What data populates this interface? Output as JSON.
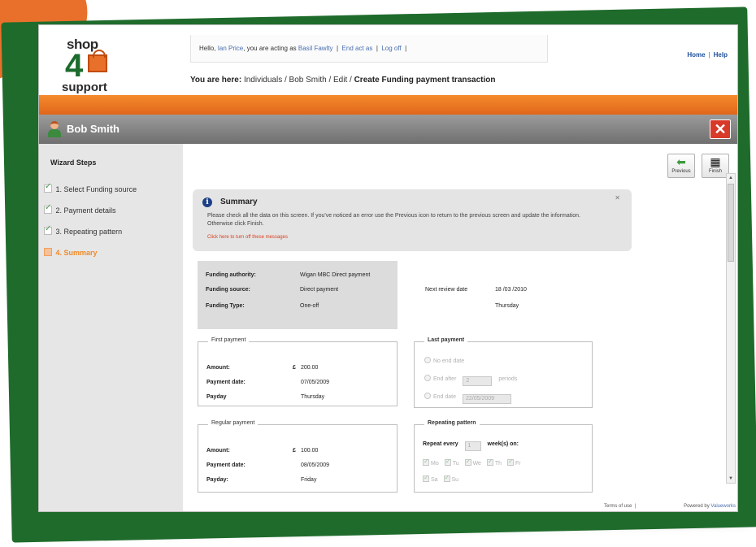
{
  "logo": {
    "line1": "shop",
    "number": "4",
    "line2": "support"
  },
  "user_bar": {
    "greeting_prefix": "Hello,",
    "user_name": "Ian Price",
    "acting_text": ", you are acting as",
    "acting_as": "Basil Fawlty",
    "sep": "|",
    "end_act": "End act as",
    "log_off": "Log off"
  },
  "breadcrumb": {
    "prefix": "You are here:",
    "path": "Individuals / Bob Smith / Edit /",
    "current": "Create Funding payment transaction"
  },
  "top_links": {
    "home": "Home",
    "sep": "|",
    "help": "Help"
  },
  "person": {
    "name": "Bob Smith",
    "close": "✕"
  },
  "wizard": {
    "title": "Wizard Steps",
    "steps": [
      {
        "label": "1. Select Funding source",
        "done": true
      },
      {
        "label": "2. Payment details",
        "done": true
      },
      {
        "label": "3. Repeating pattern",
        "done": true
      },
      {
        "label": "4. Summary",
        "active": true
      }
    ]
  },
  "nav_buttons": {
    "previous": "Previous",
    "finish": "Finish",
    "previous_icon": "arrow-left-icon",
    "finish_icon": "checkered-flag-icon"
  },
  "summary": {
    "title": "Summary",
    "text": "Please check all the data on this screen. If you've noticed an error use the Previous icon to return to the previous screen and update the information. Otherwise click Finish.",
    "turn_off": "Click here to turn off these messages",
    "close": "✕"
  },
  "funding": {
    "authority_label": "Funding authority:",
    "authority": "Wigan MBC Direct payment",
    "source_label": "Funding source:",
    "source": "Direct payment",
    "type_label": "Funding Type:",
    "type": "One-off"
  },
  "review": {
    "label": "Next review date",
    "date": "18 /03 /2010",
    "day": "Thursday"
  },
  "first_payment": {
    "legend": "First payment",
    "amount_label": "Amount:",
    "currency": "£",
    "amount": "200.00",
    "date_label": "Payment date:",
    "date": "07/05/2009",
    "payday_label": "Payday",
    "payday": "Thursday"
  },
  "last_payment": {
    "legend": "Last payment",
    "no_end": "No end date",
    "end_after": "End after",
    "periods_value": "2",
    "periods": "periods",
    "end_date": "End date",
    "end_date_value": "22/05/2009"
  },
  "regular_payment": {
    "legend": "Regular payment",
    "amount_label": "Amount:",
    "currency": "£",
    "amount": "100.00",
    "date_label": "Payment date:",
    "date": "08/05/2009",
    "payday_label": "Payday:",
    "payday": "Friday"
  },
  "repeating": {
    "legend": "Repeating pattern",
    "repeat_label": "Repeat every",
    "repeat_value": "1",
    "weeks_label": "week(s) on:",
    "days": [
      "Mo",
      "Tu",
      "We",
      "Th",
      "Fr",
      "Sa",
      "Su"
    ]
  },
  "footer": {
    "terms": "Terms of use",
    "sep": "|",
    "powered_prefix": "Powered by",
    "powered_brand": "Valueworks"
  },
  "colors": {
    "brand_orange": "#e8702a",
    "brand_green": "#1f6b2c",
    "close_red": "#d83a2a",
    "active_step": "#f08a2a"
  }
}
